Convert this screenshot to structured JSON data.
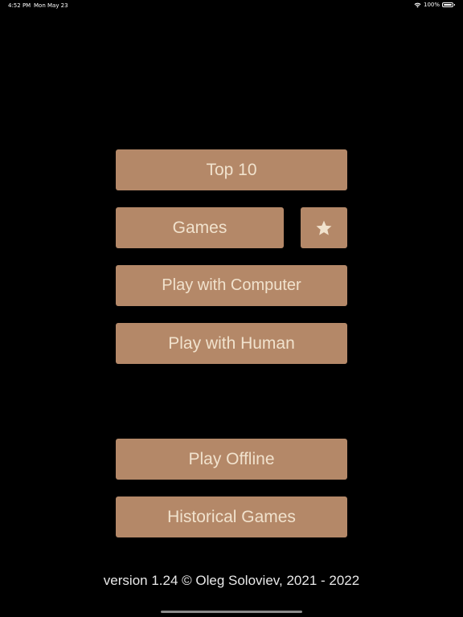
{
  "status_bar": {
    "time": "4:52 PM",
    "date": "Mon May 23",
    "battery": "100%",
    "wifi_icon": "wifi-icon",
    "battery_icon": "battery-icon"
  },
  "menu": {
    "top10_label": "Top 10",
    "games_label": "Games",
    "favorites_icon": "star-icon",
    "play_computer_label": "Play with Computer",
    "play_human_label": "Play with Human",
    "play_offline_label": "Play Offline",
    "historical_games_label": "Historical Games"
  },
  "footer": {
    "version_text": "version 1.24 © Oleg Soloviev, 2021 - 2022"
  },
  "colors": {
    "background": "#000000",
    "button_bg": "#b48868",
    "button_text": "#f1e2cd",
    "footer_text": "#e8e8e8"
  }
}
